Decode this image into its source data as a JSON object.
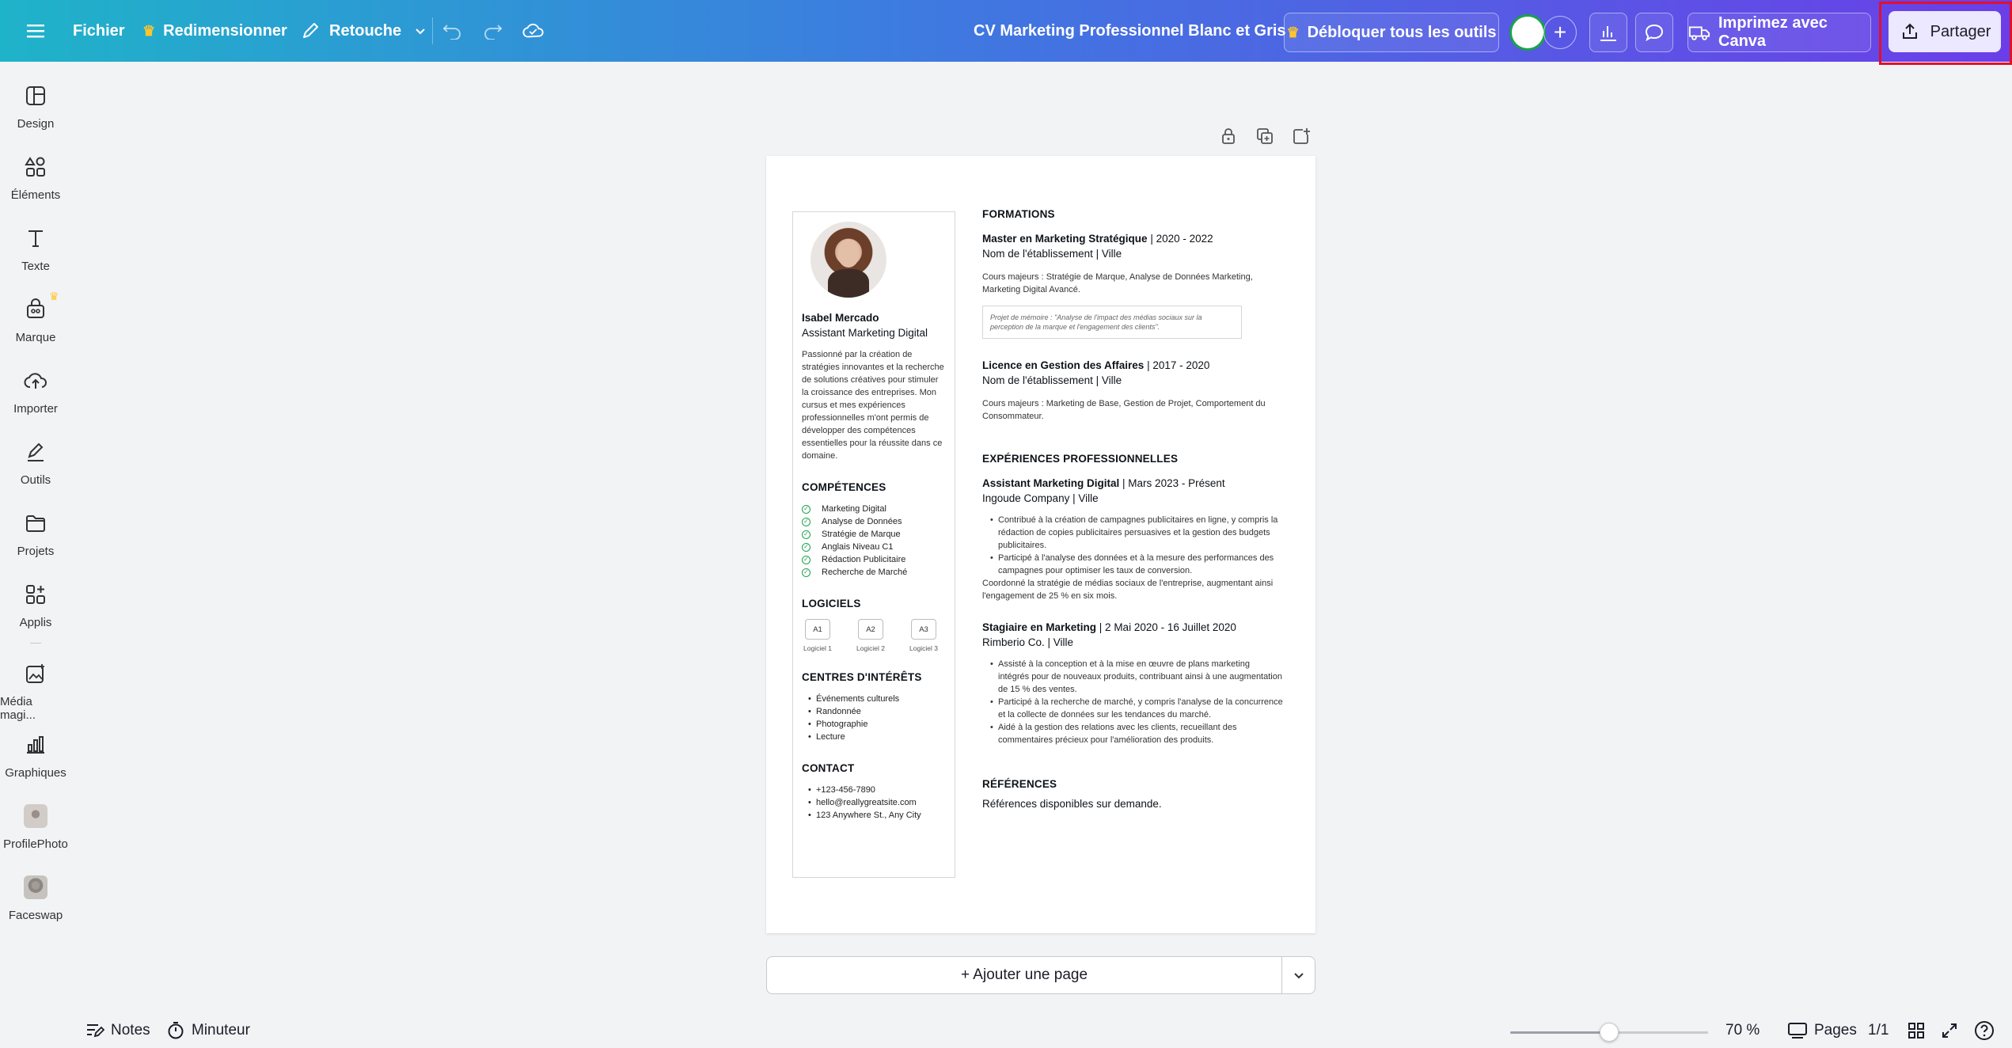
{
  "topbar": {
    "file_label": "Fichier",
    "resize_label": "Redimensionner",
    "edit_label": "Retouche",
    "doc_title": "CV Marketing Professionnel Blanc et Gris",
    "unlock_label": "Débloquer tous les outils",
    "print_label": "Imprimez avec Canva",
    "share_label": "Partager"
  },
  "sidebar": {
    "items": [
      {
        "label": "Design",
        "icon": "layout-icon"
      },
      {
        "label": "Éléments",
        "icon": "shapes-icon"
      },
      {
        "label": "Texte",
        "icon": "text-icon"
      },
      {
        "label": "Marque",
        "icon": "brand-icon"
      },
      {
        "label": "Importer",
        "icon": "cloud-upload-icon"
      },
      {
        "label": "Outils",
        "icon": "pen-icon"
      },
      {
        "label": "Projets",
        "icon": "folder-icon"
      },
      {
        "label": "Applis",
        "icon": "apps-icon"
      },
      {
        "label": "Média magi...",
        "icon": "magic-media-icon"
      },
      {
        "label": "Graphiques",
        "icon": "chart-icon"
      },
      {
        "label": "ProfilePhoto",
        "icon": "profile-photo-icon"
      },
      {
        "label": "Faceswap",
        "icon": "faceswap-icon"
      }
    ]
  },
  "resume": {
    "name": "Isabel Mercado",
    "role": "Assistant Marketing Digital",
    "bio": "Passionné par la création de stratégies innovantes et la recherche de solutions créatives pour stimuler la croissance des entreprises. Mon cursus et mes expériences professionnelles m'ont permis de développer des compétences essentielles pour la réussite dans ce domaine.",
    "skills_title": "COMPÉTENCES",
    "skills": [
      "Marketing Digital",
      "Analyse de Données",
      "Stratégie de Marque",
      "Anglais Niveau C1",
      "Rédaction Publicitaire",
      "Recherche de Marché"
    ],
    "software_title": "LOGICIELS",
    "software": [
      {
        "code": "A1",
        "label": "Logiciel 1"
      },
      {
        "code": "A2",
        "label": "Logiciel 2"
      },
      {
        "code": "A3",
        "label": "Logiciel 3"
      }
    ],
    "interests_title": "CENTRES D'INTÉRÊTS",
    "interests": [
      "Événements culturels",
      "Randonnée",
      "Photographie",
      "Lecture"
    ],
    "contact_title": "CONTACT",
    "contact": [
      "+123-456-7890",
      "hello@reallygreatsite.com",
      "123 Anywhere St., Any City"
    ],
    "formations_title": "FORMATIONS",
    "formations": [
      {
        "degree": "Master en Marketing Stratégique",
        "years": " | 2020 - 2022",
        "school": "Nom de l'établissement | Ville",
        "courses": "Cours majeurs : Stratégie de Marque, Analyse de Données Marketing, Marketing Digital Avancé.",
        "memo": "Projet de mémoire : \"Analyse de l'impact des médias sociaux sur la perception de la marque et l'engagement des clients\"."
      },
      {
        "degree": "Licence en Gestion des Affaires",
        "years": " | 2017 - 2020",
        "school": "Nom de l'établissement | Ville",
        "courses": "Cours majeurs : Marketing de Base, Gestion de Projet, Comportement du Consommateur."
      }
    ],
    "experience_title": "EXPÉRIENCES PROFESSIONNELLES",
    "experiences": [
      {
        "title": "Assistant Marketing Digital",
        "dates": " | Mars 2023 - Présent",
        "company": "Ingoude Company | Ville",
        "bullets": [
          "Contribué à la création de campagnes publicitaires en ligne, y compris la rédaction de copies publicitaires persuasives et la gestion des budgets publicitaires.",
          "Participé à l'analyse des données et à la mesure des performances des campagnes pour optimiser les taux de conversion."
        ],
        "note": "Coordonné la stratégie de médias sociaux de l'entreprise, augmentant ainsi l'engagement de 25 % en six mois."
      },
      {
        "title": "Stagiaire en Marketing",
        "dates": " | 2 Mai 2020 - 16 Juillet 2020",
        "company": "Rimberio Co. | Ville",
        "bullets": [
          "Assisté à la conception et à la mise en œuvre de plans marketing intégrés pour de nouveaux produits, contribuant ainsi à une augmentation de 15 % des ventes.",
          "Participé à la recherche de marché, y compris l'analyse de la concurrence et la collecte de données sur les tendances du marché.",
          "Aidé à la gestion des relations avec les clients, recueillant des commentaires précieux pour l'amélioration des produits."
        ]
      }
    ],
    "references_title": "RÉFÉRENCES",
    "references": "Références disponibles sur demande."
  },
  "canvas": {
    "add_page_label": "+ Ajouter une page"
  },
  "bottombar": {
    "notes_label": "Notes",
    "timer_label": "Minuteur",
    "zoom_label": "70 %",
    "zoom_fraction": 0.5,
    "pages_label": "Pages",
    "page_count": "1/1"
  },
  "colors": {
    "accent_green": "#19a34a",
    "highlight_red": "#e0112b",
    "crown_gold": "#ffc62a"
  }
}
